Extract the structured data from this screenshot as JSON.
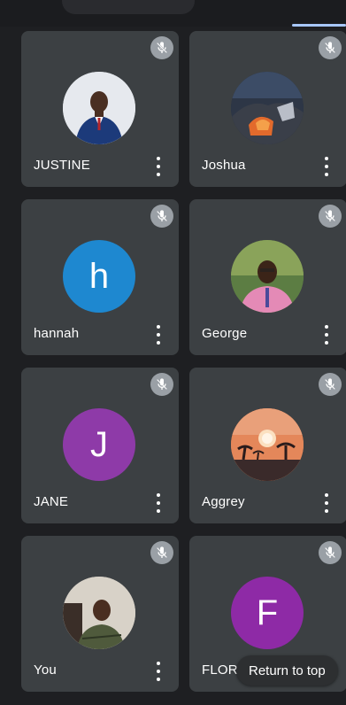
{
  "participants": [
    {
      "name": "JUSTINE",
      "avatar": "photo-man-suit",
      "muted": true
    },
    {
      "name": "Joshua",
      "avatar": "photo-observatory",
      "muted": true
    },
    {
      "name": "hannah",
      "avatar": "letter",
      "letter": "h",
      "color": "#1e88d0",
      "muted": true
    },
    {
      "name": "George",
      "avatar": "photo-man-shirt",
      "muted": true
    },
    {
      "name": "JANE",
      "avatar": "letter",
      "letter": "J",
      "color": "#8e3aa8",
      "muted": true
    },
    {
      "name": "Aggrey",
      "avatar": "photo-sunset-trees",
      "muted": true
    },
    {
      "name": "You",
      "avatar": "photo-man-sitting",
      "muted": true
    },
    {
      "name": "FLOR",
      "avatar": "letter",
      "letter": "F",
      "color": "#8e2aa6",
      "muted": true
    }
  ],
  "return_to_top_label": "Return to top",
  "icons": {
    "mute": "mic-off-icon",
    "more": "more-vert-icon"
  }
}
